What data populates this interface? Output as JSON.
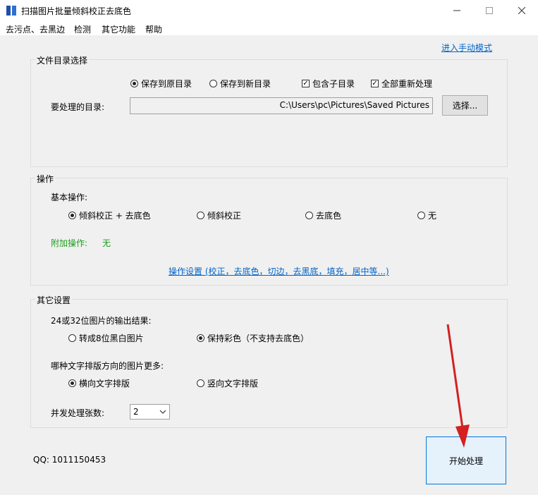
{
  "window": {
    "title": "扫描图片批量倾斜校正去底色"
  },
  "menu": {
    "items": [
      "去污点、去黑边",
      "检测",
      "其它功能",
      "帮助"
    ]
  },
  "manual_mode_link": "进入手动模式",
  "directory_group": {
    "title": "文件目录选择",
    "radio_save_original": "保存到原目录",
    "radio_save_new": "保存到新目录",
    "check_subdir": "包含子目录",
    "check_reprocess_all": "全部重新处理",
    "dir_label": "要处理的目录:",
    "dir_value": "C:\\Users\\pc\\Pictures\\Saved Pictures",
    "choose_button": "选择..."
  },
  "operation_group": {
    "title": "操作",
    "basic_label": "基本操作:",
    "options": [
      "倾斜校正 + 去底色",
      "倾斜校正",
      "去底色",
      "无"
    ],
    "selected": 0,
    "extra_label": "附加操作:",
    "extra_value": "无",
    "settings_link": "操作设置 (校正，去底色，切边，去黑底，填充，居中等...)"
  },
  "other_group": {
    "title": "其它设置",
    "output_label": "24或32位图片的输出结果:",
    "output_options": [
      "转成8位黑白图片",
      "保持彩色（不支持去底色）"
    ],
    "output_selected": 1,
    "text_dir_label": "哪种文字排版方向的图片更多:",
    "text_dir_options": [
      "横向文字排版",
      "竖向文字排版"
    ],
    "text_dir_selected": 0,
    "concurrency_label": "并发处理张数:",
    "concurrency_value": "2"
  },
  "footer": {
    "qq": "QQ: 1011150453",
    "start_button": "开始处理"
  },
  "colors": {
    "accent_link": "#0066cc",
    "green_text": "#1a9e1a",
    "annotation_arrow": "#d42020"
  }
}
